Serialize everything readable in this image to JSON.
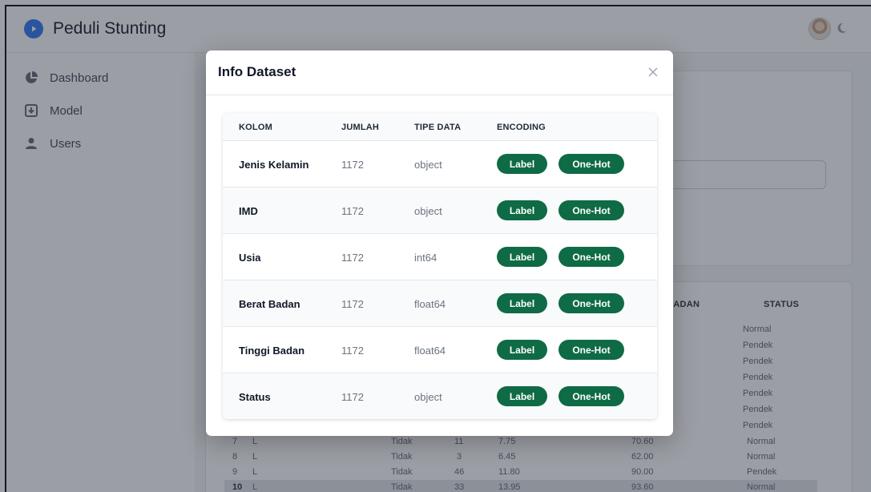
{
  "app": {
    "title": "Peduli Stunting"
  },
  "sidebar": {
    "items": [
      {
        "label": "Dashboard",
        "icon": "pie-chart-icon"
      },
      {
        "label": "Model",
        "icon": "model-icon"
      },
      {
        "label": "Users",
        "icon": "user-icon"
      }
    ]
  },
  "background_table": {
    "headers": [
      "BADAN",
      "STATUS"
    ],
    "status_column": [
      "Normal",
      "Pendek",
      "Pendek",
      "Pendek",
      "Pendek",
      "Pendek",
      "Pendek"
    ],
    "rows": [
      {
        "no": "7",
        "jk": "L",
        "imd": "Tidak",
        "usia": "11",
        "berat": "7.75",
        "tinggi": "70.60",
        "status": "Normal"
      },
      {
        "no": "8",
        "jk": "L",
        "imd": "Tidak",
        "usia": "3",
        "berat": "6.45",
        "tinggi": "62.00",
        "status": "Normal"
      },
      {
        "no": "9",
        "jk": "L",
        "imd": "Tidak",
        "usia": "46",
        "berat": "11.80",
        "tinggi": "90.00",
        "status": "Pendek"
      },
      {
        "no": "10",
        "jk": "L",
        "imd": "Tidak",
        "usia": "33",
        "berat": "13.95",
        "tinggi": "93.60",
        "status": "Normal"
      }
    ]
  },
  "modal": {
    "title": "Info Dataset",
    "columns": [
      "KOLOM",
      "JUMLAH",
      "TIPE DATA",
      "ENCODING"
    ],
    "label_button": "Label",
    "onehot_button": "One-Hot",
    "rows": [
      {
        "kolom": "Jenis Kelamin",
        "jumlah": "1172",
        "tipe": "object"
      },
      {
        "kolom": "IMD",
        "jumlah": "1172",
        "tipe": "object"
      },
      {
        "kolom": "Usia",
        "jumlah": "1172",
        "tipe": "int64"
      },
      {
        "kolom": "Berat Badan",
        "jumlah": "1172",
        "tipe": "float64"
      },
      {
        "kolom": "Tinggi Badan",
        "jumlah": "1172",
        "tipe": "float64"
      },
      {
        "kolom": "Status",
        "jumlah": "1172",
        "tipe": "object"
      }
    ]
  },
  "colors": {
    "accent": "#3b82f6",
    "button": "#0f6b45"
  }
}
